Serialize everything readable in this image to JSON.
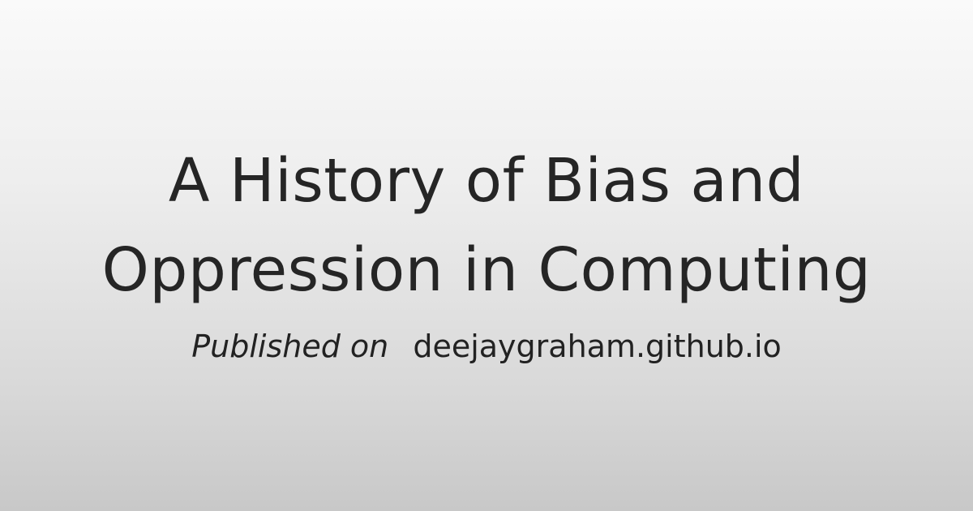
{
  "title": {
    "line1": "A History of Bias and",
    "line2": "Oppression in Computing"
  },
  "byline": {
    "label": "Published on",
    "site": "deejaygraham.github.io"
  }
}
